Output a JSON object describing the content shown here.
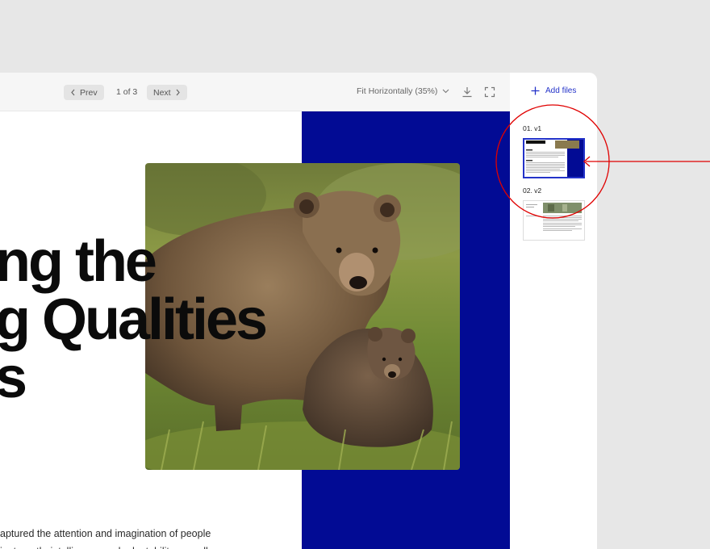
{
  "toolbar": {
    "prev_label": "Prev",
    "page_indicator": "1 of 3",
    "next_label": "Next",
    "zoom_label": "Fit Horizontally (35%)"
  },
  "document": {
    "headline_lines": [
      "ng the",
      "g Qualities",
      "s"
    ],
    "body_lines": [
      "aptured the attention and imagination of people",
      "ir strength, intelligence and adaptability as well"
    ]
  },
  "sidebar": {
    "add_files_label": "Add files",
    "files": [
      {
        "label": "01. v1",
        "selected": true
      },
      {
        "label": "02. v2",
        "selected": false
      }
    ]
  },
  "colors": {
    "accent": "#2433c9",
    "doc_blue": "#020b94",
    "annotation_red": "#e00000"
  }
}
